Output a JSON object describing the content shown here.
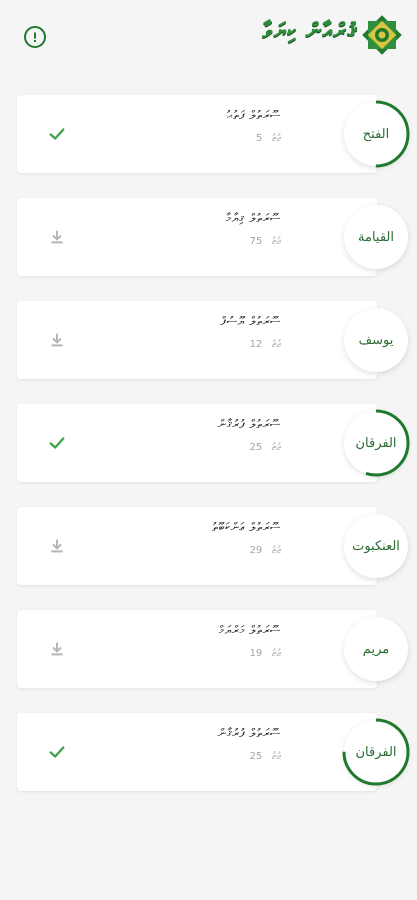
{
  "header": {
    "app_title": "ޤުރްއާން ކިޔަވާ",
    "info_icon": "info-circle-icon",
    "logo_icon": "emblem-logo-icon"
  },
  "colors": {
    "accent": "#1f7a2e",
    "check": "#3fa34d",
    "download": "#b5b5b5",
    "ring_track": "#e6e6e6"
  },
  "items": [
    {
      "title": "ސޫރަތުލް ފަތުޙު",
      "count": "5",
      "count_label": "ޖުޒު",
      "calligraphy": "الفتح",
      "status": "downloaded",
      "progress": 0.5
    },
    {
      "title": "ސޫރަތުލް ޤިޔާމާ",
      "count": "75",
      "count_label": "ޖުޒު",
      "calligraphy": "القيامة",
      "status": "download",
      "progress": 0
    },
    {
      "title": "ސޫރަތުލް ޔޫސުފް",
      "count": "12",
      "count_label": "ޖުޒު",
      "calligraphy": "يوسف",
      "status": "download",
      "progress": 0
    },
    {
      "title": "ސޫރަތުލް ފުރުޤާން",
      "count": "25",
      "count_label": "ޖުޒު",
      "calligraphy": "الفرقان",
      "status": "downloaded",
      "progress": 0.55
    },
    {
      "title": "ސޫރަތުލް ޢަންކަބޫތު",
      "count": "29",
      "count_label": "ޖުޒު",
      "calligraphy": "العنكبوت",
      "status": "download",
      "progress": 0
    },
    {
      "title": "ސޫރަތުލް މަރްޔަމް",
      "count": "19",
      "count_label": "ޖުޒު",
      "calligraphy": "مريم",
      "status": "download",
      "progress": 0
    },
    {
      "title": "ސޫރަތުލް ފުރުޤާން",
      "count": "25",
      "count_label": "ޖުޒު",
      "calligraphy": "الفرقان",
      "status": "downloaded",
      "progress": 0.75
    }
  ]
}
